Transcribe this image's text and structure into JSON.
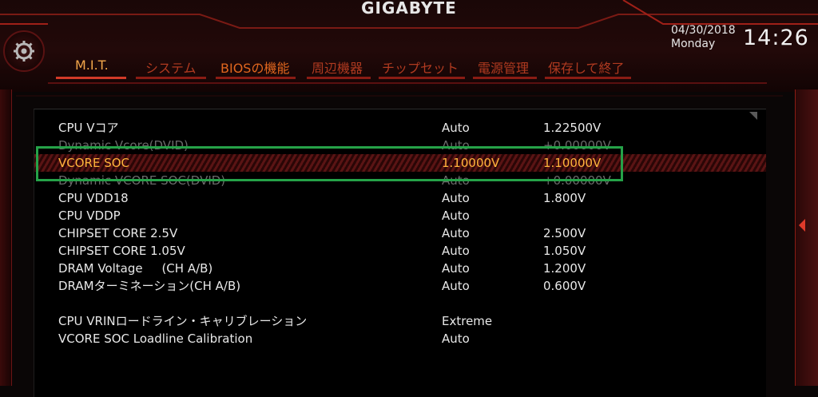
{
  "header": {
    "brand": "GIGABYTE",
    "date": "04/30/2018",
    "weekday": "Monday",
    "time": "14:26"
  },
  "tabs": [
    {
      "label": "M.I.T.",
      "active": true
    },
    {
      "label": "システム",
      "active": false
    },
    {
      "label": "BIOSの機能",
      "active": false
    },
    {
      "label": "周辺機器",
      "active": false
    },
    {
      "label": "チップセット",
      "active": false
    },
    {
      "label": "電源管理",
      "active": false
    },
    {
      "label": "保存して終了",
      "active": false
    }
  ],
  "settings": [
    {
      "label": "CPU Vコア",
      "setting": "Auto",
      "value": "1.22500V"
    },
    {
      "label": "Dynamic Vcore(DVID)",
      "setting": "Auto",
      "value": "+0.00000V"
    },
    {
      "label": "VCORE SOC",
      "setting": "1.10000V",
      "value": "1.10000V"
    },
    {
      "label": "Dynamic VCORE SOC(DVID)",
      "setting": "Auto",
      "value": "+0.00000V"
    },
    {
      "label": "CPU VDD18",
      "setting": "Auto",
      "value": "1.800V"
    },
    {
      "label": "CPU VDDP",
      "setting": "Auto",
      "value": ""
    },
    {
      "label": "CHIPSET CORE 2.5V",
      "setting": "Auto",
      "value": "2.500V"
    },
    {
      "label": "CHIPSET CORE 1.05V",
      "setting": "Auto",
      "value": "1.050V"
    },
    {
      "label": "DRAM Voltage     (CH A/B)",
      "setting": "Auto",
      "value": "1.200V"
    },
    {
      "label": "DRAMターミネーション(CH A/B)",
      "setting": "Auto",
      "value": "0.600V"
    },
    {
      "label": "CPU VRINロードライン・キャリブレーション",
      "setting": "Extreme",
      "value": ""
    },
    {
      "label": "VCORE SOC Loadline Calibration",
      "setting": "Auto",
      "value": ""
    }
  ],
  "colors": {
    "accent_red": "#d23a28",
    "highlight_text": "#ffb43c",
    "selection_box": "#25a248"
  }
}
